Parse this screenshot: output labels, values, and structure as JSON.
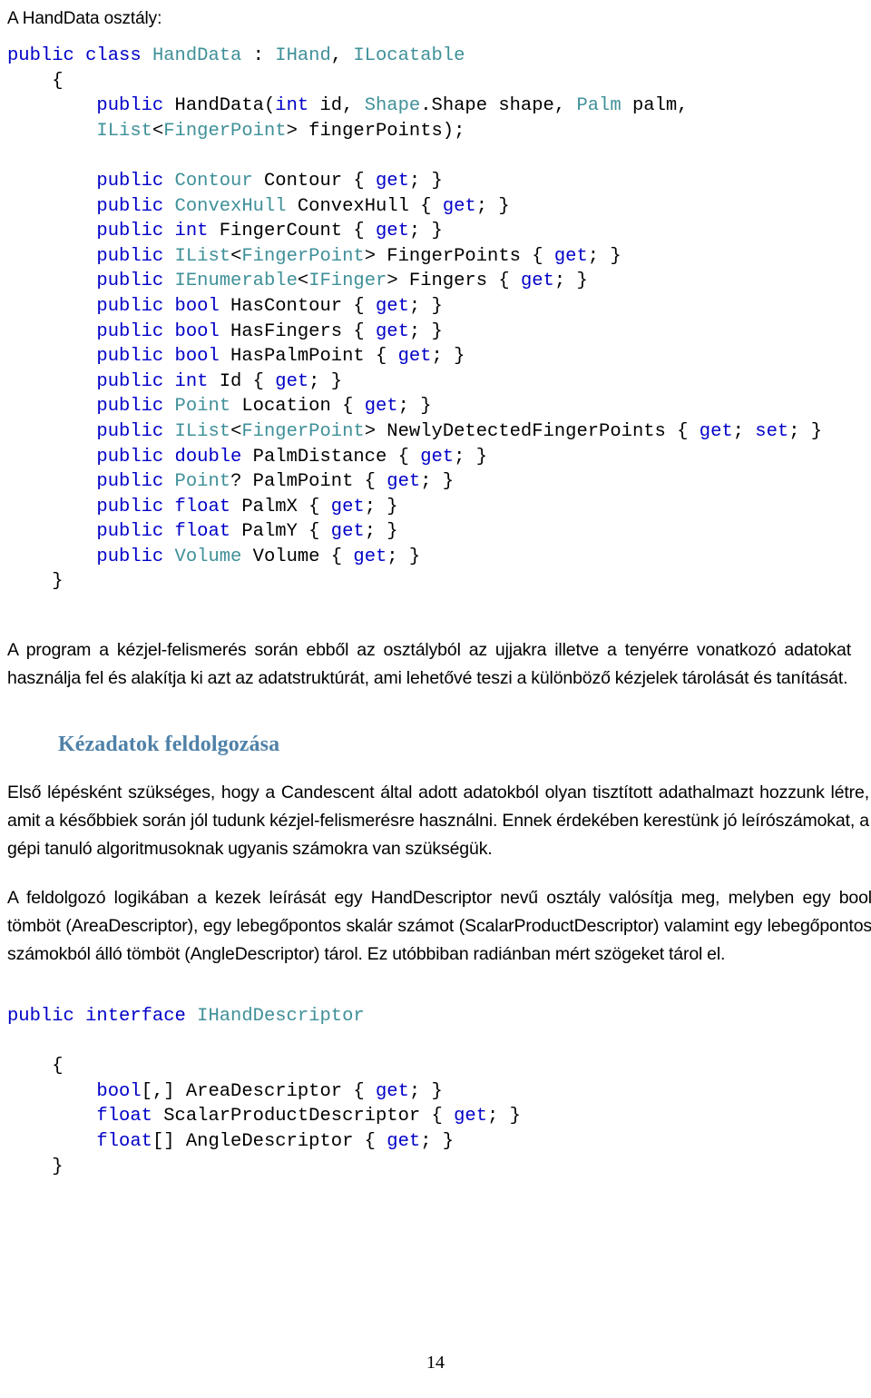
{
  "document": {
    "intro_line": "A HandData osztály:",
    "page_number": "14"
  },
  "code_block_1": {
    "name": "HandData class declaration",
    "lines": [
      [
        {
          "t": "public class ",
          "c": "kw"
        },
        {
          "t": "HandData",
          "c": "ty"
        },
        {
          "t": " : ",
          "c": "pl"
        },
        {
          "t": "IHand",
          "c": "ty"
        },
        {
          "t": ", ",
          "c": "pl"
        },
        {
          "t": "ILocatable",
          "c": "ty"
        }
      ],
      [
        {
          "t": "    {",
          "c": "pl"
        }
      ],
      [
        {
          "t": "        ",
          "c": "pl"
        },
        {
          "t": "public ",
          "c": "kw"
        },
        {
          "t": "HandData(",
          "c": "pl"
        },
        {
          "t": "int ",
          "c": "kw"
        },
        {
          "t": "id, ",
          "c": "pl"
        },
        {
          "t": "Shape",
          "c": "ty"
        },
        {
          "t": ".Shape shape, ",
          "c": "pl"
        },
        {
          "t": "Palm",
          "c": "ty"
        },
        {
          "t": " palm,",
          "c": "pl"
        }
      ],
      [
        {
          "t": "        ",
          "c": "pl"
        },
        {
          "t": "IList",
          "c": "ty"
        },
        {
          "t": "<",
          "c": "pl"
        },
        {
          "t": "FingerPoint",
          "c": "ty"
        },
        {
          "t": "> fingerPoints);",
          "c": "pl"
        }
      ],
      [
        {
          "t": "",
          "c": "pl"
        }
      ],
      [
        {
          "t": "        ",
          "c": "pl"
        },
        {
          "t": "public ",
          "c": "kw"
        },
        {
          "t": "Contour",
          "c": "ty"
        },
        {
          "t": " Contour { ",
          "c": "pl"
        },
        {
          "t": "get",
          "c": "kw"
        },
        {
          "t": "; }",
          "c": "pl"
        }
      ],
      [
        {
          "t": "        ",
          "c": "pl"
        },
        {
          "t": "public ",
          "c": "kw"
        },
        {
          "t": "ConvexHull",
          "c": "ty"
        },
        {
          "t": " ConvexHull { ",
          "c": "pl"
        },
        {
          "t": "get",
          "c": "kw"
        },
        {
          "t": "; }",
          "c": "pl"
        }
      ],
      [
        {
          "t": "        ",
          "c": "pl"
        },
        {
          "t": "public int ",
          "c": "kw"
        },
        {
          "t": "FingerCount { ",
          "c": "pl"
        },
        {
          "t": "get",
          "c": "kw"
        },
        {
          "t": "; }",
          "c": "pl"
        }
      ],
      [
        {
          "t": "        ",
          "c": "pl"
        },
        {
          "t": "public ",
          "c": "kw"
        },
        {
          "t": "IList",
          "c": "ty"
        },
        {
          "t": "<",
          "c": "pl"
        },
        {
          "t": "FingerPoint",
          "c": "ty"
        },
        {
          "t": "> FingerPoints { ",
          "c": "pl"
        },
        {
          "t": "get",
          "c": "kw"
        },
        {
          "t": "; }",
          "c": "pl"
        }
      ],
      [
        {
          "t": "        ",
          "c": "pl"
        },
        {
          "t": "public ",
          "c": "kw"
        },
        {
          "t": "IEnumerable",
          "c": "ty"
        },
        {
          "t": "<",
          "c": "pl"
        },
        {
          "t": "IFinger",
          "c": "ty"
        },
        {
          "t": "> Fingers { ",
          "c": "pl"
        },
        {
          "t": "get",
          "c": "kw"
        },
        {
          "t": "; }",
          "c": "pl"
        }
      ],
      [
        {
          "t": "        ",
          "c": "pl"
        },
        {
          "t": "public bool ",
          "c": "kw"
        },
        {
          "t": "HasContour { ",
          "c": "pl"
        },
        {
          "t": "get",
          "c": "kw"
        },
        {
          "t": "; }",
          "c": "pl"
        }
      ],
      [
        {
          "t": "        ",
          "c": "pl"
        },
        {
          "t": "public bool ",
          "c": "kw"
        },
        {
          "t": "HasFingers { ",
          "c": "pl"
        },
        {
          "t": "get",
          "c": "kw"
        },
        {
          "t": "; }",
          "c": "pl"
        }
      ],
      [
        {
          "t": "        ",
          "c": "pl"
        },
        {
          "t": "public bool ",
          "c": "kw"
        },
        {
          "t": "HasPalmPoint { ",
          "c": "pl"
        },
        {
          "t": "get",
          "c": "kw"
        },
        {
          "t": "; }",
          "c": "pl"
        }
      ],
      [
        {
          "t": "        ",
          "c": "pl"
        },
        {
          "t": "public int ",
          "c": "kw"
        },
        {
          "t": "Id { ",
          "c": "pl"
        },
        {
          "t": "get",
          "c": "kw"
        },
        {
          "t": "; }",
          "c": "pl"
        }
      ],
      [
        {
          "t": "        ",
          "c": "pl"
        },
        {
          "t": "public ",
          "c": "kw"
        },
        {
          "t": "Point",
          "c": "ty"
        },
        {
          "t": " Location { ",
          "c": "pl"
        },
        {
          "t": "get",
          "c": "kw"
        },
        {
          "t": "; }",
          "c": "pl"
        }
      ],
      [
        {
          "t": "        ",
          "c": "pl"
        },
        {
          "t": "public ",
          "c": "kw"
        },
        {
          "t": "IList",
          "c": "ty"
        },
        {
          "t": "<",
          "c": "pl"
        },
        {
          "t": "FingerPoint",
          "c": "ty"
        },
        {
          "t": "> NewlyDetectedFingerPoints { ",
          "c": "pl"
        },
        {
          "t": "get",
          "c": "kw"
        },
        {
          "t": "; ",
          "c": "pl"
        },
        {
          "t": "set",
          "c": "kw"
        },
        {
          "t": "; }",
          "c": "pl"
        }
      ],
      [
        {
          "t": "        ",
          "c": "pl"
        },
        {
          "t": "public double ",
          "c": "kw"
        },
        {
          "t": "PalmDistance { ",
          "c": "pl"
        },
        {
          "t": "get",
          "c": "kw"
        },
        {
          "t": "; }",
          "c": "pl"
        }
      ],
      [
        {
          "t": "        ",
          "c": "pl"
        },
        {
          "t": "public ",
          "c": "kw"
        },
        {
          "t": "Point",
          "c": "ty"
        },
        {
          "t": "? PalmPoint { ",
          "c": "pl"
        },
        {
          "t": "get",
          "c": "kw"
        },
        {
          "t": "; }",
          "c": "pl"
        }
      ],
      [
        {
          "t": "        ",
          "c": "pl"
        },
        {
          "t": "public float ",
          "c": "kw"
        },
        {
          "t": "PalmX { ",
          "c": "pl"
        },
        {
          "t": "get",
          "c": "kw"
        },
        {
          "t": "; }",
          "c": "pl"
        }
      ],
      [
        {
          "t": "        ",
          "c": "pl"
        },
        {
          "t": "public float ",
          "c": "kw"
        },
        {
          "t": "PalmY { ",
          "c": "pl"
        },
        {
          "t": "get",
          "c": "kw"
        },
        {
          "t": "; }",
          "c": "pl"
        }
      ],
      [
        {
          "t": "        ",
          "c": "pl"
        },
        {
          "t": "public ",
          "c": "kw"
        },
        {
          "t": "Volume",
          "c": "ty"
        },
        {
          "t": " Volume { ",
          "c": "pl"
        },
        {
          "t": "get",
          "c": "kw"
        },
        {
          "t": "; }",
          "c": "pl"
        }
      ],
      [
        {
          "t": "    }",
          "c": "pl"
        }
      ]
    ]
  },
  "code_block_2": {
    "name": "IHandDescriptor interface declaration",
    "lines": [
      [
        {
          "t": "public interface ",
          "c": "kw"
        },
        {
          "t": "IHandDescriptor",
          "c": "ty"
        }
      ],
      [
        {
          "t": "",
          "c": "pl"
        }
      ],
      [
        {
          "t": "    {",
          "c": "pl"
        }
      ],
      [
        {
          "t": "        ",
          "c": "pl"
        },
        {
          "t": "bool",
          "c": "kw"
        },
        {
          "t": "[,] AreaDescriptor { ",
          "c": "pl"
        },
        {
          "t": "get",
          "c": "kw"
        },
        {
          "t": "; }",
          "c": "pl"
        }
      ],
      [
        {
          "t": "        ",
          "c": "pl"
        },
        {
          "t": "float ",
          "c": "kw"
        },
        {
          "t": "ScalarProductDescriptor { ",
          "c": "pl"
        },
        {
          "t": "get",
          "c": "kw"
        },
        {
          "t": "; }",
          "c": "pl"
        }
      ],
      [
        {
          "t": "        ",
          "c": "pl"
        },
        {
          "t": "float",
          "c": "kw"
        },
        {
          "t": "[] AngleDescriptor { ",
          "c": "pl"
        },
        {
          "t": "get",
          "c": "kw"
        },
        {
          "t": "; }",
          "c": "pl"
        }
      ],
      [
        {
          "t": "    }",
          "c": "pl"
        }
      ]
    ]
  },
  "paragraphs": {
    "p1": "A program a kézjel-felismerés során ebből az osztályból az ujjakra illetve a tenyérre vonatkozó adatokat használja fel és alakítja ki azt az adatstruktúrát, ami lehetővé teszi a különböző kézjelek tárolását és tanítását.",
    "heading_1": "Kézadatok feldolgozása",
    "p2": "Első lépésként szükséges, hogy a Candescent által adott adatokból olyan tisztított adathalmazt hozzunk létre, amit a későbbiek során jól tudunk kézjel-felismerésre használni. Ennek érdekében kerestünk jó leírószámokat, a gépi tanuló algoritmusoknak ugyanis számokra van szükségük.",
    "p3": "A feldolgozó logikában a kezek leírását egy HandDescriptor nevű osztály valósítja meg, melyben egy bool tömböt (AreaDescriptor), egy lebegőpontos skalár számot (ScalarProductDescriptor) valamint egy lebegőpontos számokból álló tömböt (AngleDescriptor) tárol. Ez utóbbiban radiánban mért szögeket tárol el."
  },
  "colors": {
    "keyword": "#0000c8",
    "type": "#3f9099",
    "plain": "#000000",
    "heading_blue": "#4f81a8",
    "background": "#ffffff"
  }
}
